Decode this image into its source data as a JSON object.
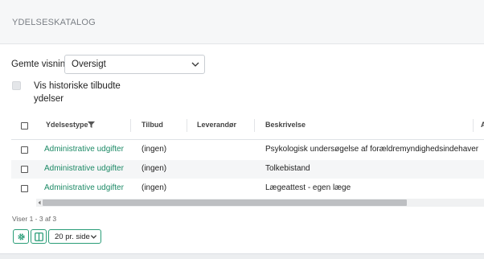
{
  "panel": {
    "title": "YDELSESKATALOG"
  },
  "saved_views": {
    "label": "Gemte visninger",
    "selected": "Oversigt"
  },
  "history_toggle": {
    "label": "Vis historiske tilbudte ydelser",
    "checked": false
  },
  "table": {
    "columns": [
      "Ydelsestype",
      "Tilbud",
      "Leverandør",
      "Beskrivelse",
      "A"
    ],
    "rows": [
      {
        "ydelsestype": "Administrative udgifter",
        "tilbud": "(ingen)",
        "leverandor": "",
        "beskrivelse": "Psykologisk undersøgelse af forældremyndighedsindehaver"
      },
      {
        "ydelsestype": "Administrative udgifter",
        "tilbud": "(ingen)",
        "leverandor": "",
        "beskrivelse": "Tolkebistand"
      },
      {
        "ydelsestype": "Administrative udgifter",
        "tilbud": "(ingen)",
        "leverandor": "",
        "beskrivelse": "Lægeattest - egen læge"
      }
    ]
  },
  "footer": {
    "info": "Viser 1 - 3 af 3",
    "page_size": "20 pr. side"
  },
  "colors": {
    "accent": "#2a9d78",
    "link": "#1d8a66"
  }
}
